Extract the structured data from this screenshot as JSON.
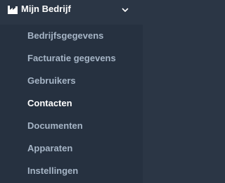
{
  "sidebar": {
    "section": {
      "label": "Mijn Bedrijf",
      "icon": "factory-icon",
      "expanded": true,
      "chevron_icon": "chevron-down-icon"
    },
    "items": [
      {
        "label": "Bedrijfsgegevens"
      },
      {
        "label": "Facturatie gegevens"
      },
      {
        "label": "Gebruikers"
      },
      {
        "label": "Contacten",
        "active": true
      },
      {
        "label": "Documenten"
      },
      {
        "label": "Apparaten"
      },
      {
        "label": "Instellingen"
      }
    ]
  },
  "colors": {
    "background": "#2b3645",
    "submenu_background": "#263140",
    "text_muted": "#a6b5c6",
    "text_active": "#ffffff"
  }
}
